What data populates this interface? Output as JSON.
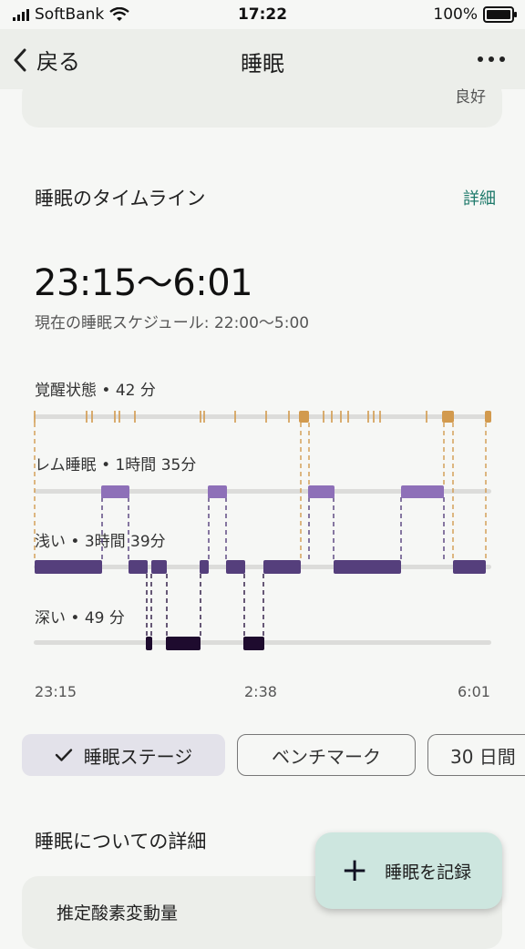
{
  "status_bar": {
    "carrier": "SoftBank",
    "time": "17:22",
    "battery": "100%"
  },
  "nav": {
    "back_label": "戻る",
    "title": "睡眠"
  },
  "top_card": {
    "text": "良好"
  },
  "timeline": {
    "title": "睡眠のタイムライン",
    "detail_link": "詳細",
    "range": "23:15〜6:01",
    "schedule": "現在の睡眠スケジュール: 22:00〜5:00",
    "stages": {
      "awake": "覚醒状態 • 42 分",
      "rem": "レム睡眠 • 1時間 35分",
      "light": "浅い • 3時間 39分",
      "deep": "深い • 49 分"
    },
    "axis": {
      "start": "23:15",
      "mid": "2:38",
      "end": "6:01"
    },
    "colors": {
      "awake": "#d29a4e",
      "rem": "#8e70b8",
      "light": "#553f7c",
      "deep": "#1e0b2e",
      "track": "#dcdcda"
    }
  },
  "chips": {
    "selected": "睡眠ステージ",
    "benchmark": "ベンチマーク",
    "days": "30 日間"
  },
  "details": {
    "title": "睡眠についての詳細",
    "card_title": "推定酸素変動量"
  },
  "fab": {
    "label": "睡眠を記録"
  }
}
